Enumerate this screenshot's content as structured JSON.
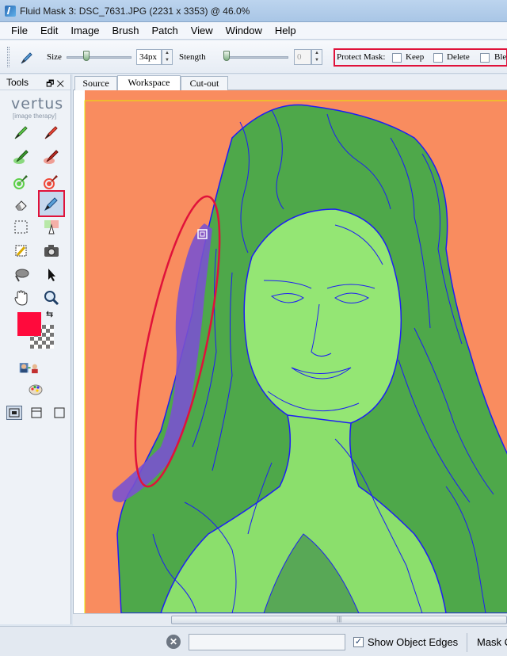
{
  "window": {
    "title": "Fluid Mask 3: DSC_7631.JPG (2231 x 3353) @ 46.0%"
  },
  "menu": [
    "File",
    "Edit",
    "Image",
    "Brush",
    "Patch",
    "View",
    "Window",
    "Help"
  ],
  "toolbar": {
    "size_label": "Size",
    "size_value": "34px",
    "strength_label": "Stength",
    "strength_value": "0",
    "protect_label": "Protect Mask:",
    "keep_label": "Keep",
    "delete_label": "Delete",
    "blend_label": "Ble"
  },
  "tools_panel": {
    "title": "Tools",
    "brand": "vertus",
    "brand_tagline": "[image therapy]",
    "selected_tool": "edge-pen",
    "foreground_color": "#ff0a3c"
  },
  "tabs": [
    {
      "label": "Source",
      "active": false
    },
    {
      "label": "Workspace",
      "active": true
    },
    {
      "label": "Cut-out",
      "active": false
    }
  ],
  "workspace": {
    "background_color": "#f98c5f",
    "keep_color": "#7ee06b",
    "edge_color": "#1d1df5",
    "annotation_color": "#e0123a"
  },
  "statusbar": {
    "show_edges_label": "Show Object Edges",
    "show_edges_checked": "✓",
    "mode_label": "Mask Cut"
  }
}
